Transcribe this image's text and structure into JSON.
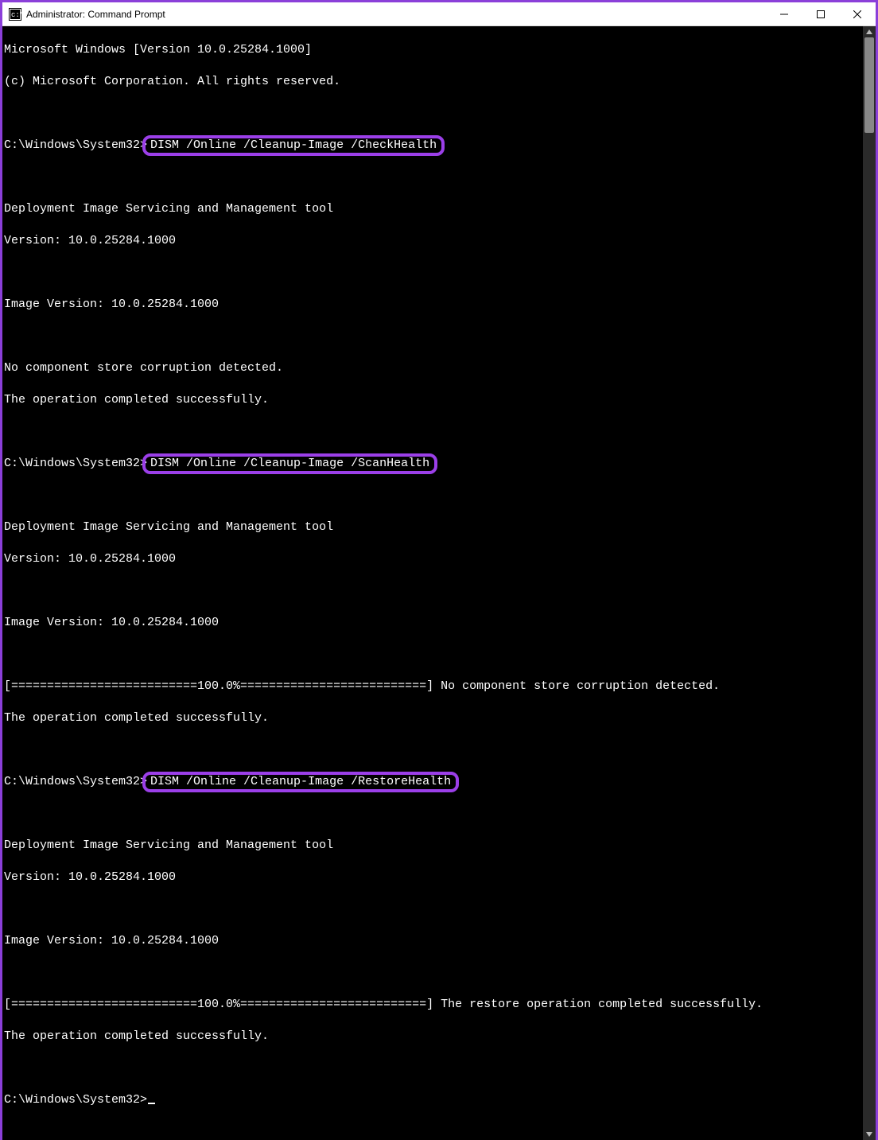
{
  "window": {
    "title": "Administrator: Command Prompt"
  },
  "terminal": {
    "header1": "Microsoft Windows [Version 10.0.25284.1000]",
    "header2": "(c) Microsoft Corporation. All rights reserved.",
    "prompt": "C:\\Windows\\System32>",
    "suffix_text": "",
    "dism_tool_line": "Deployment Image Servicing and Management tool",
    "version_line": "Version: 10.0.25284.1000",
    "image_version_line": "Image Version: 10.0.25284.1000",
    "no_corruption": "No component store corruption detected.",
    "op_success": "The operation completed successfully.",
    "cmd1": "DISM /Online /Cleanup-Image /CheckHealth",
    "cmd2": "DISM /Online /Cleanup-Image /ScanHealth",
    "cmd3": "DISM /Online /Cleanup-Image /RestoreHealth",
    "progress_bar": "[==========================100.0%==========================]",
    "progress_no_corruption": " No component store corruption detected.",
    "progress_restore_success": " The restore operation completed successfully.",
    "blank": ""
  },
  "colors": {
    "accent": "#8B3FD9",
    "highlight_border": "#9B3FE8",
    "terminal_bg": "#000000",
    "terminal_fg": "#ffffff"
  }
}
